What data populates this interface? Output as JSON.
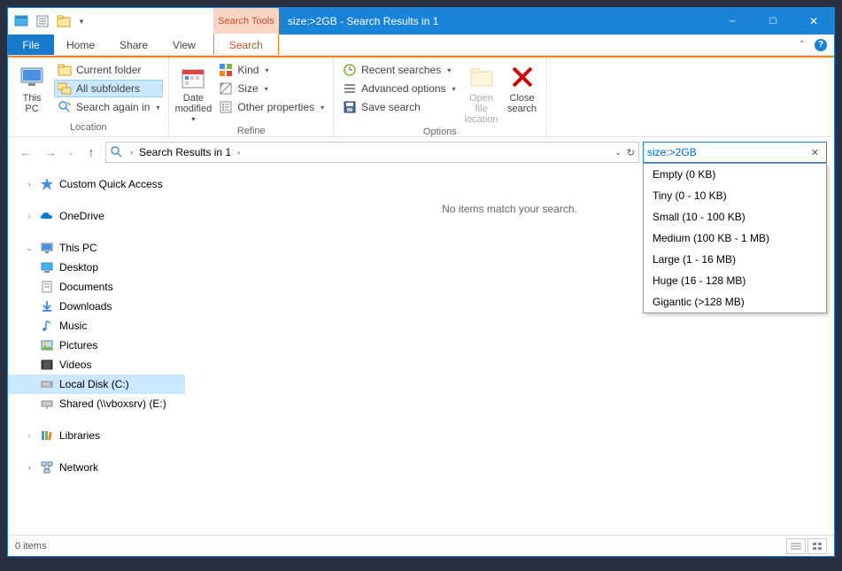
{
  "window": {
    "search_tools_label": "Search Tools",
    "title": "size:>2GB - Search Results in 1"
  },
  "tabs": {
    "file": "File",
    "home": "Home",
    "share": "Share",
    "view": "View",
    "search": "Search"
  },
  "ribbon": {
    "groups": {
      "location": "Location",
      "refine": "Refine",
      "options": "Options"
    },
    "this_pc": "This\nPC",
    "current_folder": "Current folder",
    "all_subfolders": "All subfolders",
    "search_again_in": "Search again in",
    "date_modified": "Date\nmodified",
    "kind": "Kind",
    "size": "Size",
    "other_properties": "Other properties",
    "recent_searches": "Recent searches",
    "advanced_options": "Advanced options",
    "save_search": "Save search",
    "open_file_location": "Open file\nlocation",
    "close_search": "Close\nsearch"
  },
  "address": {
    "path": "Search Results in 1"
  },
  "search": {
    "value": "size:>2GB",
    "dropdown": [
      "Empty (0 KB)",
      "Tiny (0 - 10 KB)",
      "Small (10 - 100 KB)",
      "Medium (100 KB - 1 MB)",
      "Large (1 - 16 MB)",
      "Huge (16 - 128 MB)",
      "Gigantic (>128 MB)"
    ]
  },
  "nav": {
    "quick_access": "Custom Quick Access",
    "onedrive": "OneDrive",
    "this_pc": "This PC",
    "desktop": "Desktop",
    "documents": "Documents",
    "downloads": "Downloads",
    "music": "Music",
    "pictures": "Pictures",
    "videos": "Videos",
    "local_disk": "Local Disk (C:)",
    "shared": "Shared (\\\\vboxsrv) (E:)",
    "libraries": "Libraries",
    "network": "Network"
  },
  "main": {
    "no_items": "No items match your search."
  },
  "status": {
    "items": "0 items"
  }
}
